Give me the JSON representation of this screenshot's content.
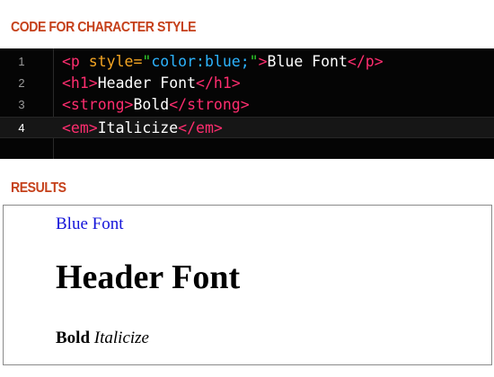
{
  "code_section": {
    "title": "CODE FOR CHARACTER STYLE",
    "lines": [
      {
        "number": "1",
        "tokens": {
          "open_tag": "<p",
          "attr_name": " style=",
          "q1": "\"",
          "attr_value": "color:blue;",
          "q2": "\"",
          "open_close": ">",
          "text": "Blue Font",
          "close_tag": "</p>"
        }
      },
      {
        "number": "2",
        "tokens": {
          "open_tag": "<h1>",
          "text": "Header Font",
          "close_tag": "</h1>"
        }
      },
      {
        "number": "3",
        "tokens": {
          "open_tag": "<strong>",
          "text": "Bold",
          "close_tag": "</strong>"
        }
      },
      {
        "number": "4",
        "tokens": {
          "open_tag": "<em>",
          "text": "Italicize",
          "close_tag": "</em>"
        }
      }
    ],
    "colors": {
      "tag": "#ff2d6f",
      "attribute": "#f5a623",
      "string_quote": "#2fd12a",
      "value": "#2db4ff",
      "text": "#ffffff",
      "background": "#050505"
    }
  },
  "results_section": {
    "title": "RESULTS",
    "blue_text": "Blue Font",
    "header_text": "Header Font",
    "bold_text": "Bold",
    "italic_text": "Italicize"
  },
  "accent_color": "#c5401a"
}
